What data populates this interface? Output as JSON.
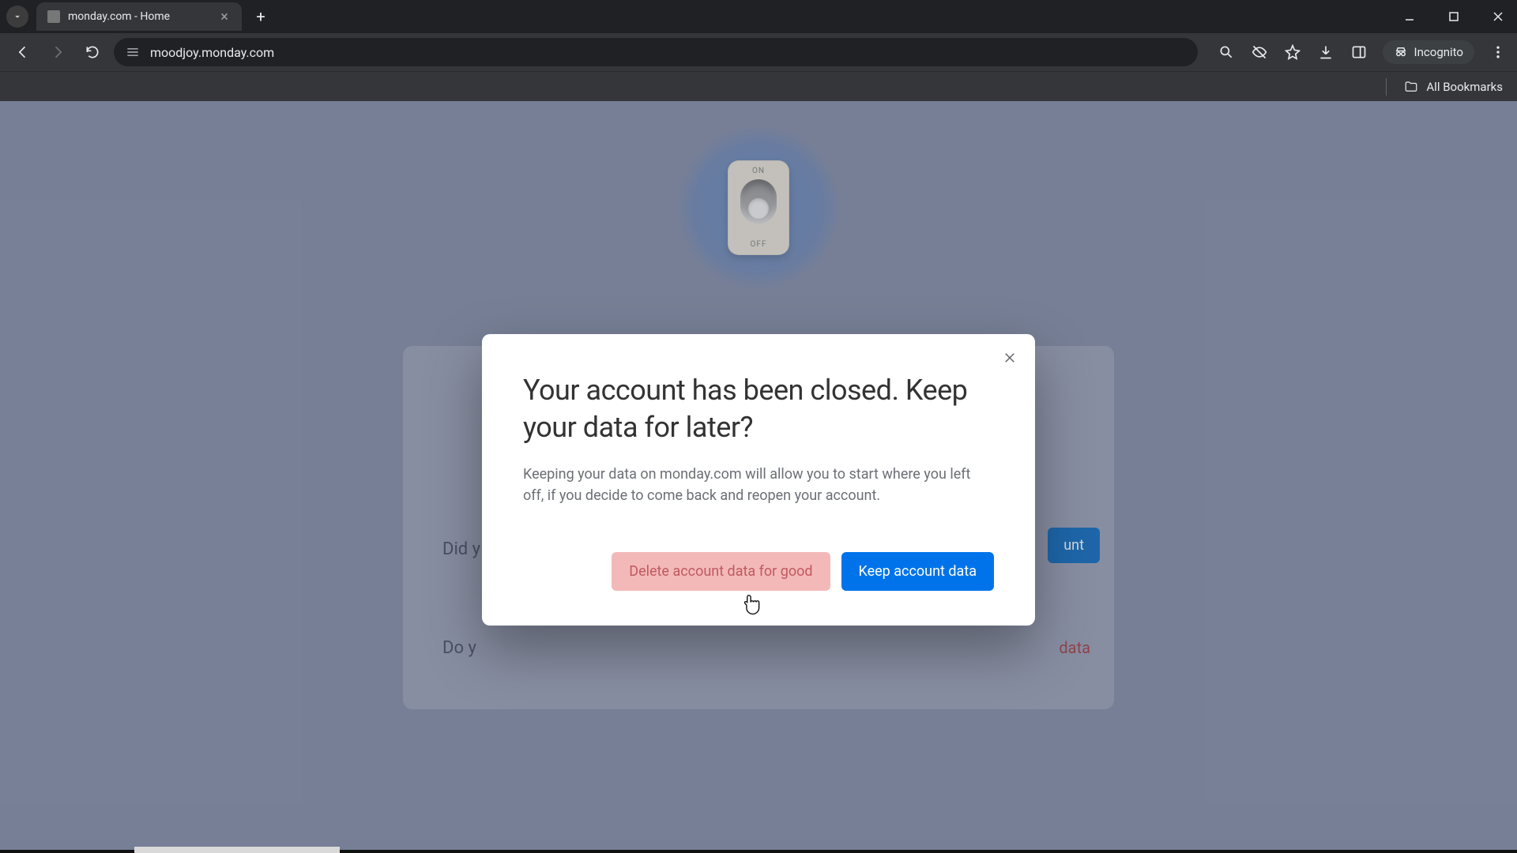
{
  "browser": {
    "tab_title": "monday.com - Home",
    "url": "moodjoy.monday.com",
    "incognito_label": "Incognito",
    "all_bookmarks": "All Bookmarks"
  },
  "background": {
    "switch_on": "ON",
    "switch_off": "OFF",
    "line1_prefix": "Did y",
    "btn1_suffix": "unt",
    "line2_prefix": "Do y",
    "link2_suffix": "data"
  },
  "modal": {
    "title": "Your account has been closed. Keep your data for later?",
    "body": "Keeping your data on monday.com will allow you to start where you left off, if you decide to come back and reopen your account.",
    "delete_label": "Delete account data for good",
    "keep_label": "Keep account data"
  }
}
